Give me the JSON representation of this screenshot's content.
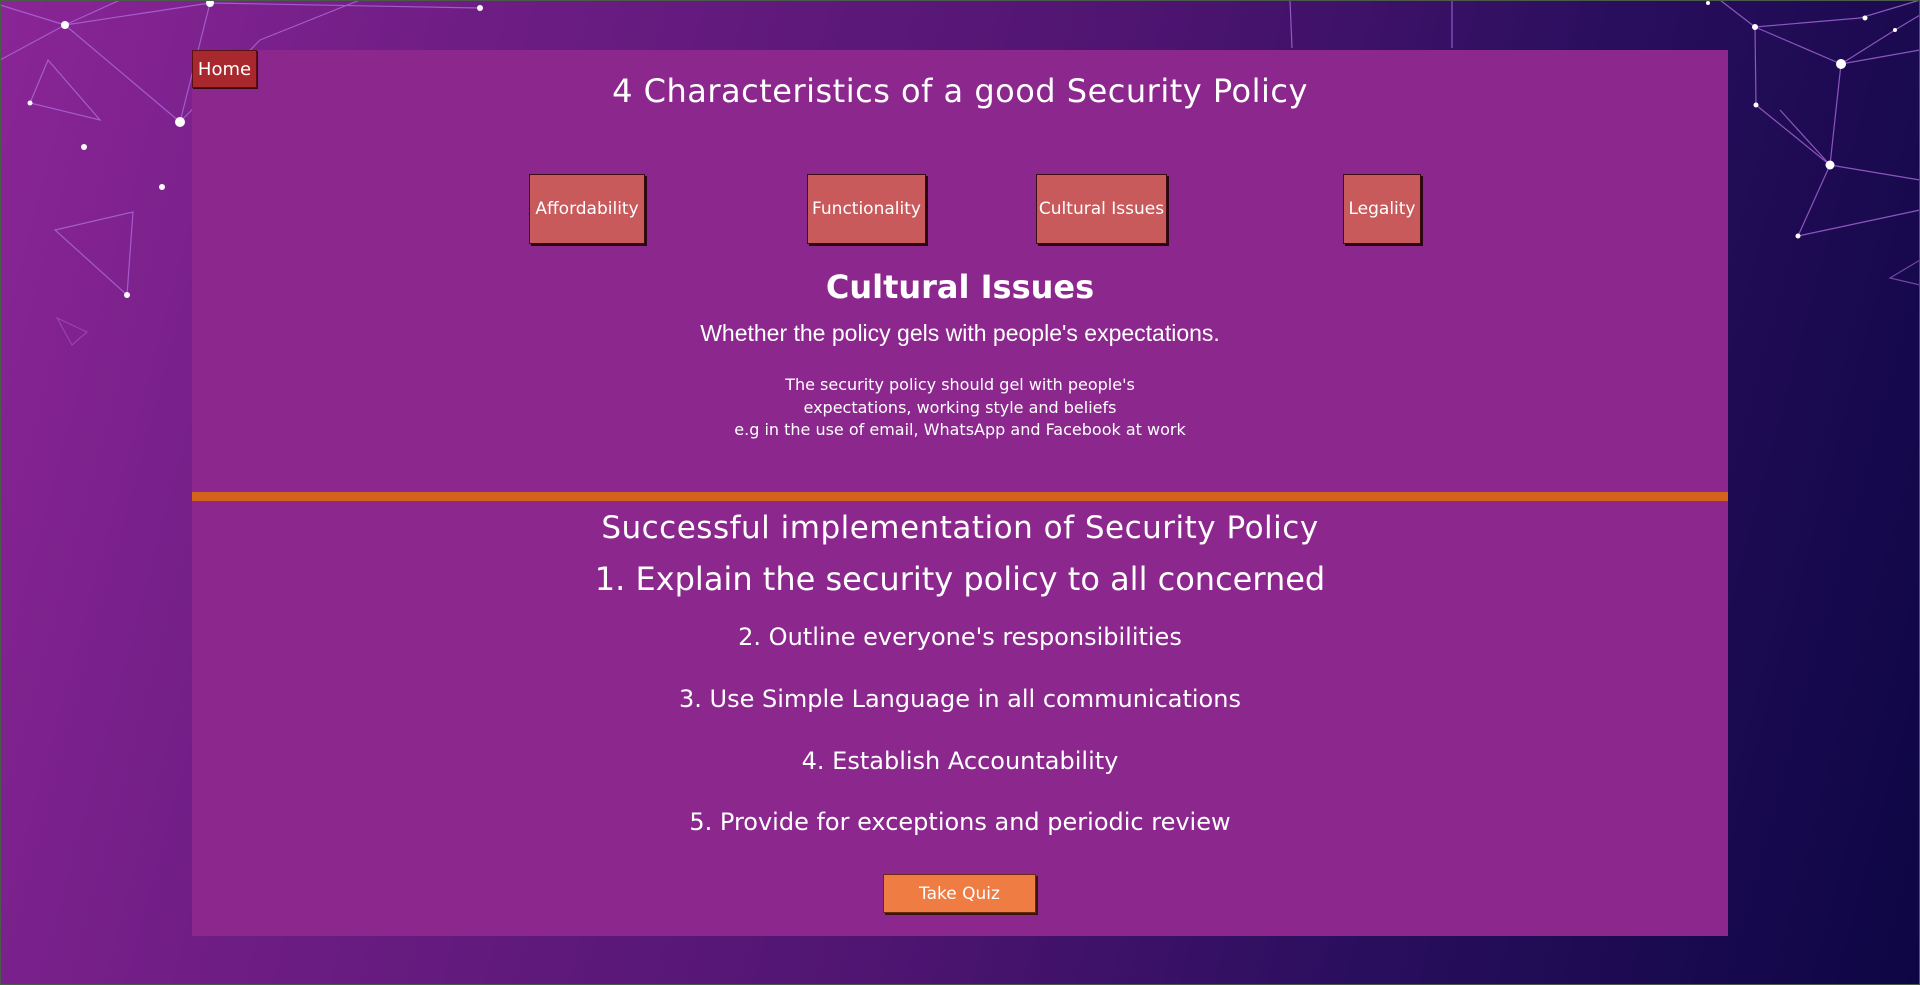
{
  "nav": {
    "home_label": "Home"
  },
  "header": {
    "title": "4 Characteristics of a good Security Policy"
  },
  "tabs": [
    {
      "label": "Affordability"
    },
    {
      "label": "Functionality"
    },
    {
      "label": "Cultural Issues"
    },
    {
      "label": "Legality"
    }
  ],
  "selected_section": {
    "heading": "Cultural Issues",
    "subtitle": "Whether the policy gels with people's expectations.",
    "body_lines": [
      "The security policy should gel with people's",
      "expectations, working style and beliefs",
      "e.g in the use of email, WhatsApp and Facebook at work"
    ]
  },
  "implementation": {
    "title": "Successful implementation of Security Policy",
    "steps": [
      "1. Explain the security policy to all concerned",
      "2. Outline everyone's responsibilities",
      "3. Use Simple Language in all communications",
      "4. Establish Accountability",
      "5. Provide for exceptions and periodic review"
    ]
  },
  "quiz": {
    "button_label": "Take Quiz"
  },
  "colors": {
    "panel": "#8c278e",
    "tab_button": "#c95a5c",
    "home_button": "#a8282e",
    "divider": "#d2621c",
    "quiz_button": "#ef7c42"
  }
}
